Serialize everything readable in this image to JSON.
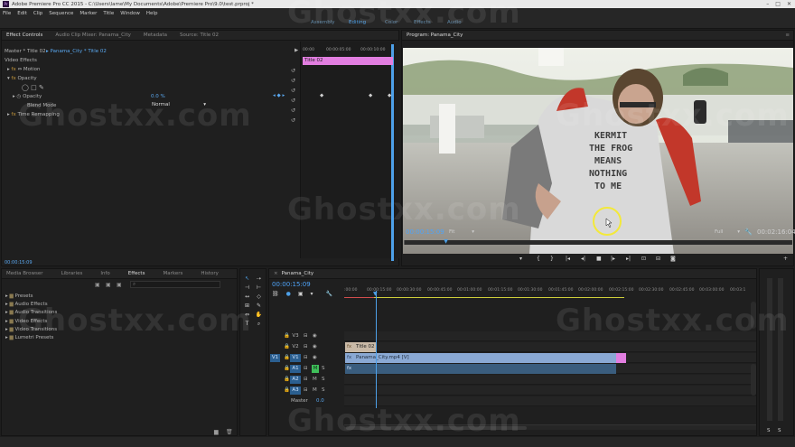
{
  "window": {
    "title": "Adobe Premiere Pro CC 2015 - C:\\Users\\lame\\My Documents\\Adobe\\Premiere Pro\\9.0\\test.prproj *",
    "logo": "Pr"
  },
  "menu": [
    "File",
    "Edit",
    "Clip",
    "Sequence",
    "Marker",
    "Title",
    "Window",
    "Help"
  ],
  "workspaces": [
    {
      "label": "Assembly",
      "active": false
    },
    {
      "label": "Editing",
      "active": true
    },
    {
      "label": "Color",
      "active": false
    },
    {
      "label": "Effects",
      "active": false
    },
    {
      "label": "Audio",
      "active": false
    }
  ],
  "effect_controls": {
    "tabs": [
      "Effect Controls",
      "Audio Clip Mixer: Panama_City",
      "Metadata",
      "Source: Title 02"
    ],
    "master": "Master * Title 02",
    "clip_link": "Panama_City * Title 02",
    "section": "Video Effects",
    "effects": [
      "Motion",
      "Opacity",
      "Time Remapping"
    ],
    "opacity_label": "Opacity",
    "opacity_value": "0.0 %",
    "blend_label": "Blend Mode",
    "blend_value": "Normal",
    "mini_times": [
      "00:00",
      "00:00:05:00",
      "00:00:10:00"
    ],
    "mini_clip": "Title 02",
    "timecode": "00:00:15:09"
  },
  "program": {
    "tab": "Program: Panama_City",
    "timecode": "00:00:15:09",
    "fit": "Fit",
    "quality": "Full",
    "duration": "00:02:16:04",
    "shirt_text": [
      "KERMIT",
      "THE FROG",
      "MEANS",
      "NOTHING",
      "TO ME"
    ],
    "playhead_fraction": 0.11
  },
  "effects_panel": {
    "tabs": [
      "Media Browser",
      "Libraries",
      "Info",
      "Effects",
      "Markers",
      "History"
    ],
    "active_tab": "Effects",
    "folders": [
      "Presets",
      "Audio Effects",
      "Audio Transitions",
      "Video Effects",
      "Video Transitions",
      "Lumetri Presets"
    ]
  },
  "timeline": {
    "tab": "Panama_City",
    "timecode": "00:00:15:09",
    "ruler": [
      ":00:00",
      "00:00:15:00",
      "00:00:30:00",
      "00:00:45:00",
      "00:01:00:00",
      "00:01:15:00",
      "00:01:30:00",
      "00:01:45:00",
      "00:02:00:00",
      "00:02:15:00",
      "00:02:30:00",
      "00:02:45:00",
      "00:03:00:00",
      "00:03:1"
    ],
    "tracks": [
      "V3",
      "V2",
      "V1",
      "A1",
      "A2",
      "A3"
    ],
    "master_label": "Master",
    "master_value": "0.0",
    "clip_title": "Title 02",
    "clip_video": "Panama_City.mp4 [V]"
  },
  "meters": {
    "labels": [
      "S",
      "S"
    ]
  },
  "watermark": "Ghostxx.com",
  "colors": {
    "accent": "#4da0e8",
    "title_clip": "#e27ee0",
    "video_clip": "#8aa9d4",
    "audio_clip": "#3a5d7e",
    "timecode": "#4fa3f7"
  }
}
